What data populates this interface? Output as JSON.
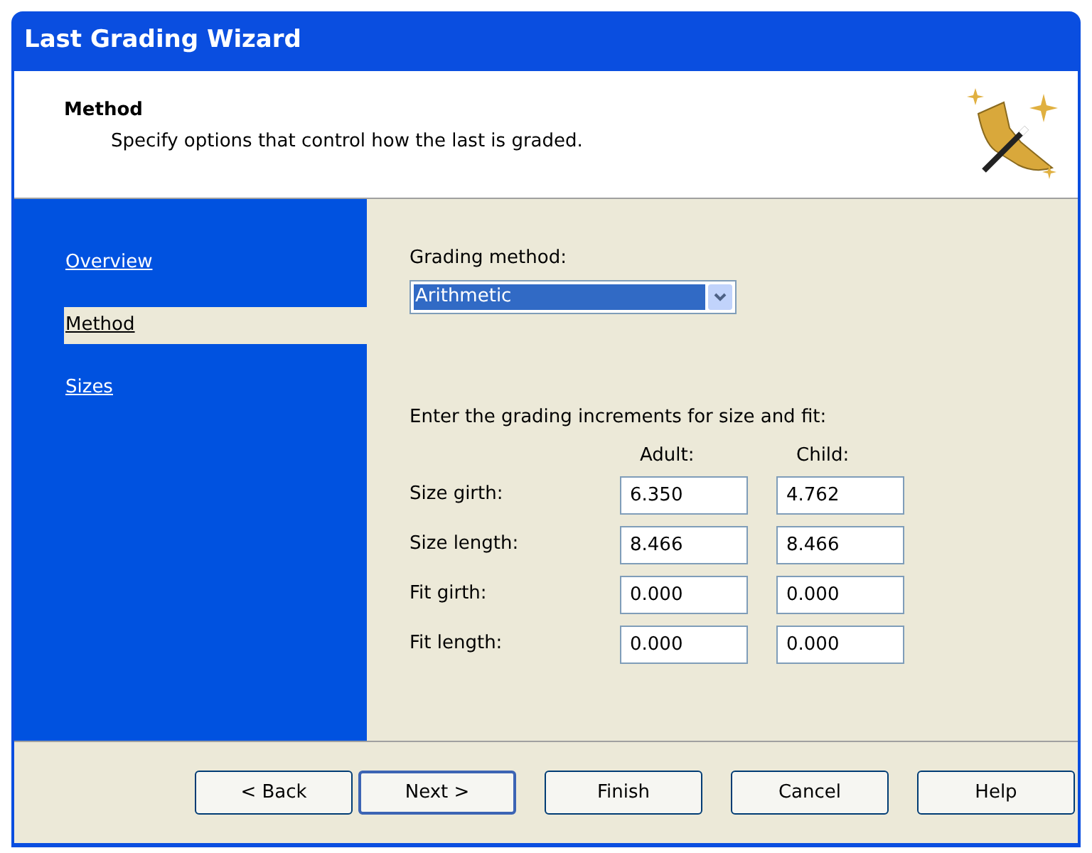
{
  "window": {
    "title": "Last Grading Wizard"
  },
  "header": {
    "title": "Method",
    "subtitle": "Specify options that control how the last is graded."
  },
  "sidebar": {
    "items": [
      {
        "label": "Overview",
        "selected": false
      },
      {
        "label": "Method",
        "selected": true
      },
      {
        "label": "Sizes",
        "selected": false
      }
    ]
  },
  "method": {
    "label": "Grading method:",
    "value": "Arithmetic"
  },
  "increments": {
    "intro": "Enter the grading increments for size and fit:",
    "columns": [
      "Adult:",
      "Child:"
    ],
    "rows": [
      {
        "label": "Size girth:",
        "values": [
          "6.350",
          "4.762"
        ]
      },
      {
        "label": "Size length:",
        "values": [
          "8.466",
          "8.466"
        ]
      },
      {
        "label": "Fit girth:",
        "values": [
          "0.000",
          "0.000"
        ]
      },
      {
        "label": "Fit length:",
        "values": [
          "0.000",
          "0.000"
        ]
      }
    ]
  },
  "buttons": [
    {
      "label": "< Back",
      "default": false
    },
    {
      "label": "Next >",
      "default": true
    },
    {
      "label": "Finish",
      "default": false
    },
    {
      "label": "Cancel",
      "default": false
    },
    {
      "label": "Help",
      "default": false
    }
  ]
}
